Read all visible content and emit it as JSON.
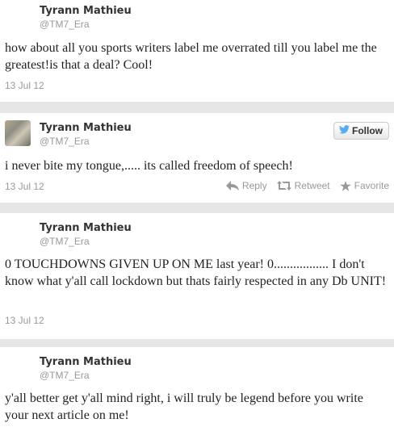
{
  "tweets": [
    {
      "name": "Tyrann Mathieu",
      "handle": "@TM7_Era",
      "text": "how about all you sports writers label me overrated till you label me the greatest!is that a deal? Cool!",
      "date": "13 Jul 12"
    },
    {
      "name": "Tyrann Mathieu",
      "handle": "@TM7_Era",
      "text": "i never bite my tongue,..... its called freedom of speech!",
      "date": "13 Jul 12",
      "follow_label": "Follow",
      "actions": {
        "reply": "Reply",
        "retweet": "Retweet",
        "favorite": "Favorite"
      }
    },
    {
      "name": "Tyrann Mathieu",
      "handle": "@TM7_Era",
      "text": "0 TOUCHDOWNS GIVEN UP ON ME last year! 0................. I don't know what y'all call lockdown but thats fairly respected in any Db UNIT!",
      "date": "13 Jul 12"
    },
    {
      "name": "Tyrann Mathieu",
      "handle": "@TM7_Era",
      "text": "y'all better get y'all mind right, i will truly be legend before you write your next article on me!"
    }
  ],
  "colors": {
    "card": "#ffffff",
    "gap": "#e6e6e6",
    "muted": "#999999",
    "twitter_blue": "#55acee"
  }
}
